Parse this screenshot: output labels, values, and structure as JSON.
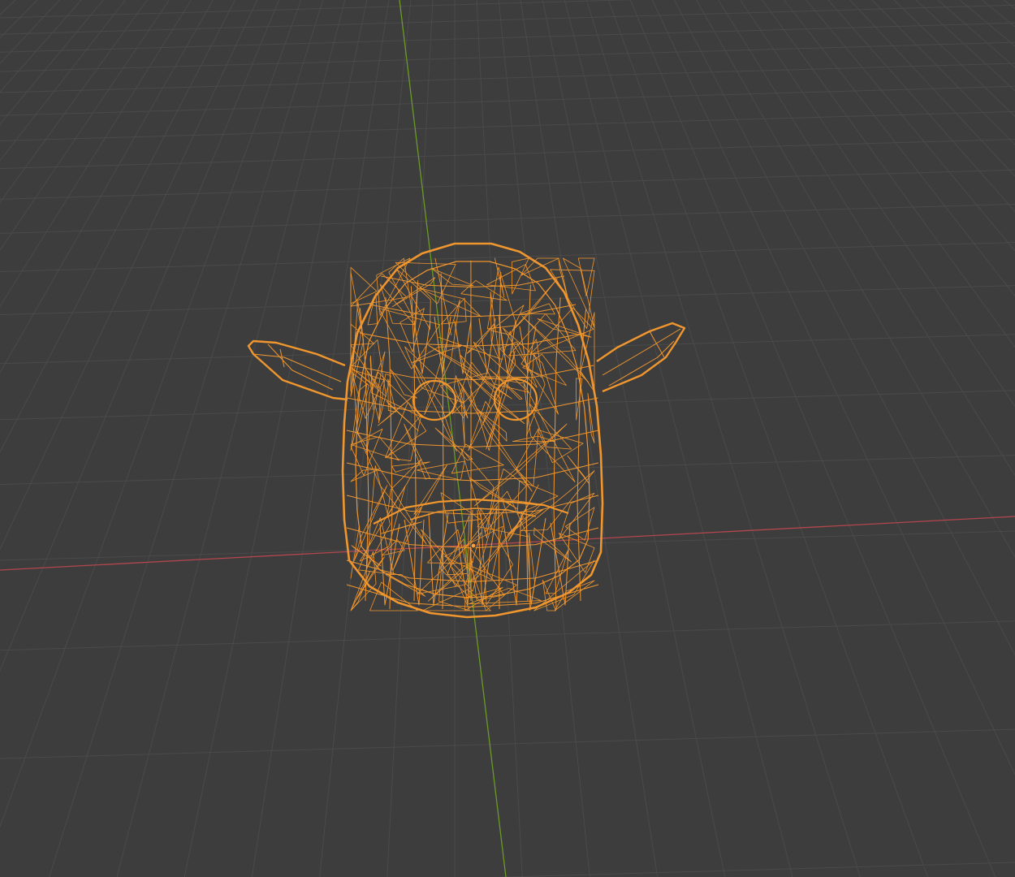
{
  "viewport": {
    "background_color": "#3d3d3d",
    "grid_color": "#4a4a4a",
    "x_axis_color": "#b3474d",
    "y_axis_color": "#6b9a28",
    "selection_color": "#f0962e",
    "origin_color": "#f5a33a",
    "object": {
      "kind": "mesh",
      "display": "wireframe",
      "selected": true,
      "shape": "creature-head-with-ears"
    }
  }
}
